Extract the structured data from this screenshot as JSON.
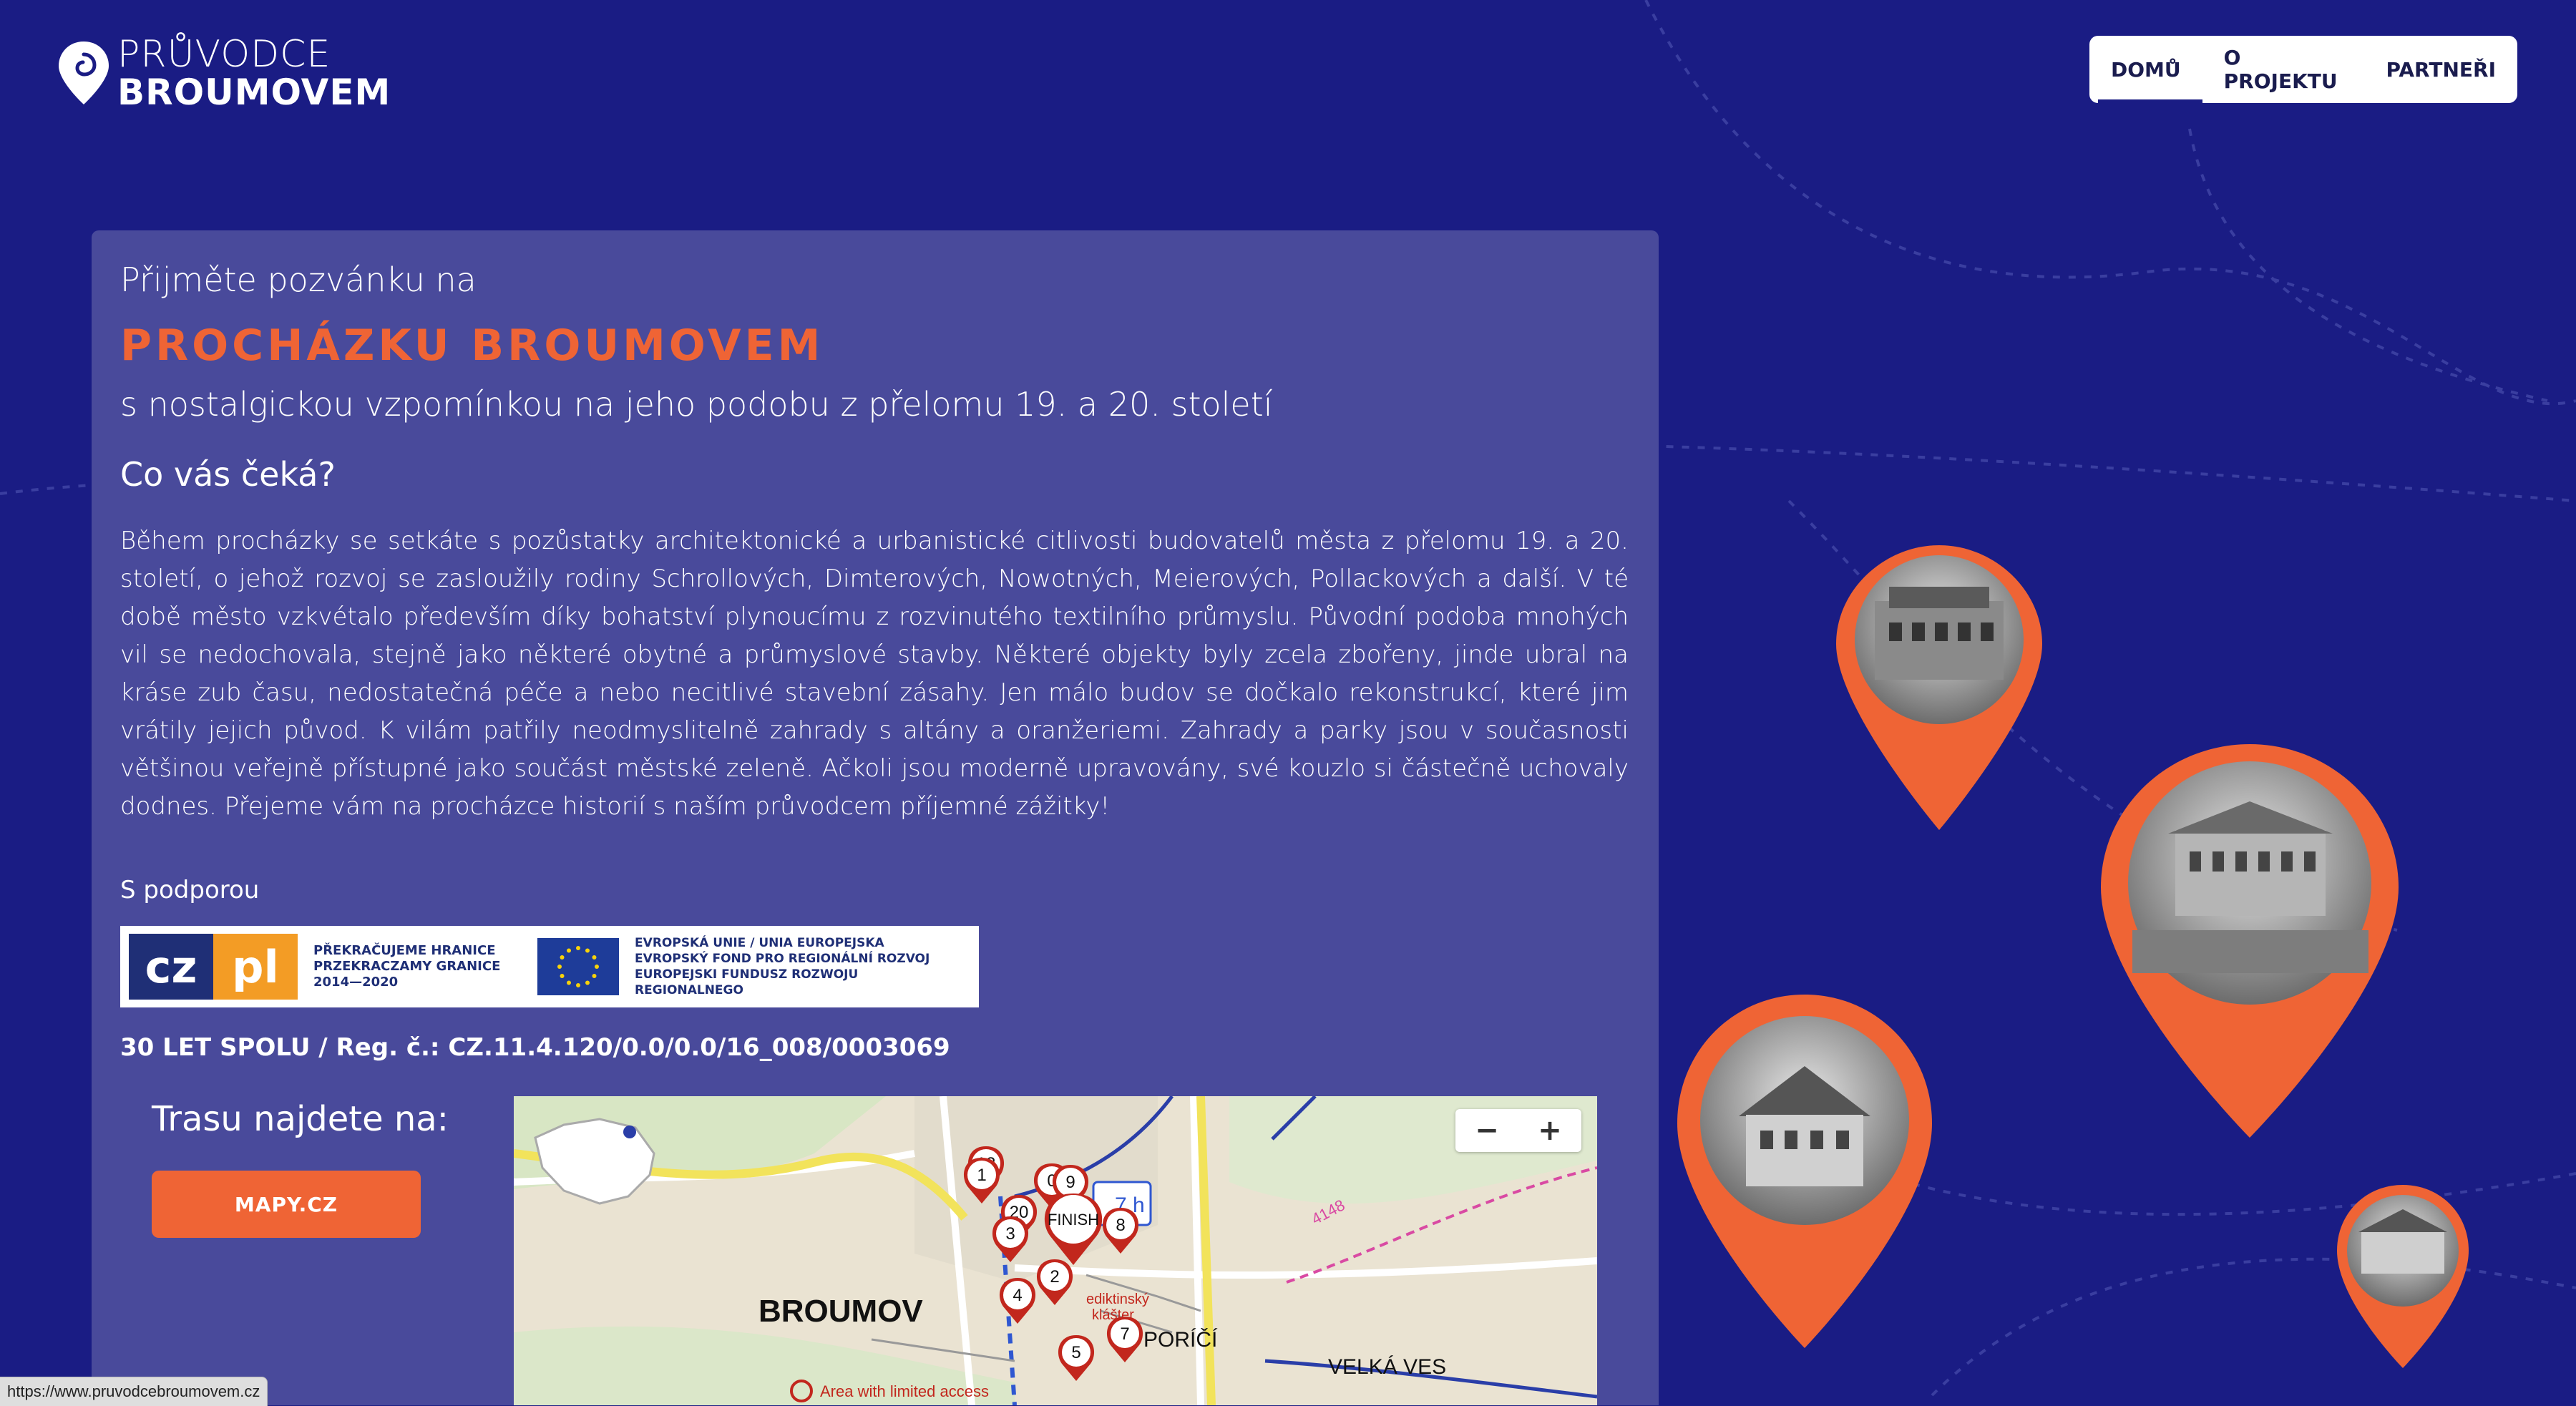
{
  "logo": {
    "line1": "PRŮVODCE",
    "line2": "BROUMOVEM"
  },
  "nav": {
    "items": [
      "DOMŮ",
      "O PROJEKTU",
      "PARTNEŘI"
    ],
    "active": "DOMŮ"
  },
  "intro": {
    "invite": "Přijměte pozvánku na",
    "headline": "PROCHÁZKU BROUMOVEM",
    "subtitle": "s nostalgickou vzpomínkou na jeho podobu z přelomu 19. a 20. století",
    "question": "Co vás čeká?",
    "body": "Během procházky se setkáte s pozůstatky architektonické a urbanistické citlivosti budovatelů města z přelomu 19. a 20. století, o jehož rozvoj se zasloužily rodiny Schrollových, Dimterových, Nowotných, Meierových, Pollackových a další. V té době město vzkvétalo především díky bohatství plynoucímu z rozvinutého textilního průmyslu. Původní podoba mnohých vil se nedochovala, stejně jako některé obytné a průmyslové stavby. Některé objekty byly zcela zbořeny, jinde ubral na kráse zub času, nedostatečná péče a nebo necitlivé stavební zásahy. Jen málo budov se dočkalo rekonstrukcí, které jim vrátily jejich původ. K vilám patřily neodmyslitelně zahrady s altány a oranžeriemi. Zahrady a parky jsou v současnosti většinou veřejně přístupné jako součást městské zeleně. Ačkoli jsou moderně upravovány, své kouzlo si částečně uchovaly dodnes. Přejeme vám na procházce historií s naším průvodcem příjemné zážitky!"
  },
  "support": {
    "label": "S podporou",
    "czpl_logo": {
      "cz": "cz",
      "pl": "pl"
    },
    "czpl_text": [
      "PŘEKRAČUJEME HRANICE",
      "PRZEKRACZAMY GRANICE",
      "2014—2020"
    ],
    "eu_text": [
      "EVROPSKÁ UNIE / UNIA EUROPEJSKA",
      "EVROPSKÝ FOND PRO REGIONÁLNÍ ROZVOJ",
      "EUROPEJSKI FUNDUSZ ROZWOJU REGIONALNEGO"
    ],
    "registration": "30 LET SPOLU / Reg. č.: CZ.11.4.120/0.0/0.0/16_008/0003069"
  },
  "route": {
    "label": "Trasu najdete na:",
    "button": "MAPY.CZ"
  },
  "map": {
    "zoom_out": "−",
    "zoom_in": "+",
    "labels": {
      "broumov": "BROUMOV",
      "porici": "PORÍČÍ",
      "velka_ves": "VELKÁ VES",
      "limited": "Area with limited access",
      "monastery_1": "ediktinský",
      "monastery_2": "klášter",
      "road": "4148"
    },
    "markers": [
      "12",
      "1",
      "0",
      "9",
      "20",
      "8",
      "FINISH",
      "3",
      "2",
      "4",
      "7",
      "5"
    ]
  },
  "status_bar": {
    "url": "https://www.pruvodcebroumovem.cz"
  },
  "colors": {
    "background": "#1a1c84",
    "card": "#494a9b",
    "accent": "#ef6435"
  }
}
